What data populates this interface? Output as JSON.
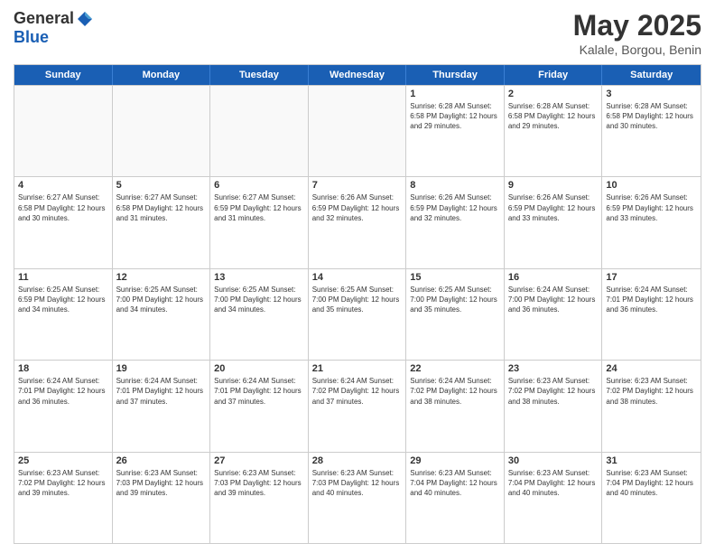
{
  "header": {
    "logo_general": "General",
    "logo_blue": "Blue",
    "month_title": "May 2025",
    "subtitle": "Kalale, Borgou, Benin"
  },
  "days_of_week": [
    "Sunday",
    "Monday",
    "Tuesday",
    "Wednesday",
    "Thursday",
    "Friday",
    "Saturday"
  ],
  "weeks": [
    [
      {
        "day": "",
        "info": ""
      },
      {
        "day": "",
        "info": ""
      },
      {
        "day": "",
        "info": ""
      },
      {
        "day": "",
        "info": ""
      },
      {
        "day": "1",
        "info": "Sunrise: 6:28 AM\nSunset: 6:58 PM\nDaylight: 12 hours\nand 29 minutes."
      },
      {
        "day": "2",
        "info": "Sunrise: 6:28 AM\nSunset: 6:58 PM\nDaylight: 12 hours\nand 29 minutes."
      },
      {
        "day": "3",
        "info": "Sunrise: 6:28 AM\nSunset: 6:58 PM\nDaylight: 12 hours\nand 30 minutes."
      }
    ],
    [
      {
        "day": "4",
        "info": "Sunrise: 6:27 AM\nSunset: 6:58 PM\nDaylight: 12 hours\nand 30 minutes."
      },
      {
        "day": "5",
        "info": "Sunrise: 6:27 AM\nSunset: 6:58 PM\nDaylight: 12 hours\nand 31 minutes."
      },
      {
        "day": "6",
        "info": "Sunrise: 6:27 AM\nSunset: 6:59 PM\nDaylight: 12 hours\nand 31 minutes."
      },
      {
        "day": "7",
        "info": "Sunrise: 6:26 AM\nSunset: 6:59 PM\nDaylight: 12 hours\nand 32 minutes."
      },
      {
        "day": "8",
        "info": "Sunrise: 6:26 AM\nSunset: 6:59 PM\nDaylight: 12 hours\nand 32 minutes."
      },
      {
        "day": "9",
        "info": "Sunrise: 6:26 AM\nSunset: 6:59 PM\nDaylight: 12 hours\nand 33 minutes."
      },
      {
        "day": "10",
        "info": "Sunrise: 6:26 AM\nSunset: 6:59 PM\nDaylight: 12 hours\nand 33 minutes."
      }
    ],
    [
      {
        "day": "11",
        "info": "Sunrise: 6:25 AM\nSunset: 6:59 PM\nDaylight: 12 hours\nand 34 minutes."
      },
      {
        "day": "12",
        "info": "Sunrise: 6:25 AM\nSunset: 7:00 PM\nDaylight: 12 hours\nand 34 minutes."
      },
      {
        "day": "13",
        "info": "Sunrise: 6:25 AM\nSunset: 7:00 PM\nDaylight: 12 hours\nand 34 minutes."
      },
      {
        "day": "14",
        "info": "Sunrise: 6:25 AM\nSunset: 7:00 PM\nDaylight: 12 hours\nand 35 minutes."
      },
      {
        "day": "15",
        "info": "Sunrise: 6:25 AM\nSunset: 7:00 PM\nDaylight: 12 hours\nand 35 minutes."
      },
      {
        "day": "16",
        "info": "Sunrise: 6:24 AM\nSunset: 7:00 PM\nDaylight: 12 hours\nand 36 minutes."
      },
      {
        "day": "17",
        "info": "Sunrise: 6:24 AM\nSunset: 7:01 PM\nDaylight: 12 hours\nand 36 minutes."
      }
    ],
    [
      {
        "day": "18",
        "info": "Sunrise: 6:24 AM\nSunset: 7:01 PM\nDaylight: 12 hours\nand 36 minutes."
      },
      {
        "day": "19",
        "info": "Sunrise: 6:24 AM\nSunset: 7:01 PM\nDaylight: 12 hours\nand 37 minutes."
      },
      {
        "day": "20",
        "info": "Sunrise: 6:24 AM\nSunset: 7:01 PM\nDaylight: 12 hours\nand 37 minutes."
      },
      {
        "day": "21",
        "info": "Sunrise: 6:24 AM\nSunset: 7:02 PM\nDaylight: 12 hours\nand 37 minutes."
      },
      {
        "day": "22",
        "info": "Sunrise: 6:24 AM\nSunset: 7:02 PM\nDaylight: 12 hours\nand 38 minutes."
      },
      {
        "day": "23",
        "info": "Sunrise: 6:23 AM\nSunset: 7:02 PM\nDaylight: 12 hours\nand 38 minutes."
      },
      {
        "day": "24",
        "info": "Sunrise: 6:23 AM\nSunset: 7:02 PM\nDaylight: 12 hours\nand 38 minutes."
      }
    ],
    [
      {
        "day": "25",
        "info": "Sunrise: 6:23 AM\nSunset: 7:02 PM\nDaylight: 12 hours\nand 39 minutes."
      },
      {
        "day": "26",
        "info": "Sunrise: 6:23 AM\nSunset: 7:03 PM\nDaylight: 12 hours\nand 39 minutes."
      },
      {
        "day": "27",
        "info": "Sunrise: 6:23 AM\nSunset: 7:03 PM\nDaylight: 12 hours\nand 39 minutes."
      },
      {
        "day": "28",
        "info": "Sunrise: 6:23 AM\nSunset: 7:03 PM\nDaylight: 12 hours\nand 40 minutes."
      },
      {
        "day": "29",
        "info": "Sunrise: 6:23 AM\nSunset: 7:04 PM\nDaylight: 12 hours\nand 40 minutes."
      },
      {
        "day": "30",
        "info": "Sunrise: 6:23 AM\nSunset: 7:04 PM\nDaylight: 12 hours\nand 40 minutes."
      },
      {
        "day": "31",
        "info": "Sunrise: 6:23 AM\nSunset: 7:04 PM\nDaylight: 12 hours\nand 40 minutes."
      }
    ]
  ]
}
